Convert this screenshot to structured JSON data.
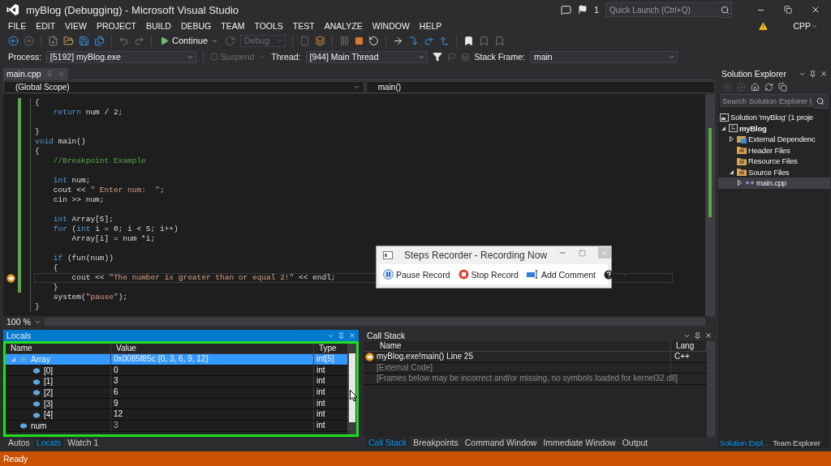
{
  "title_bar": {
    "title": "myBlog (Debugging) - Microsoft Visual Studio",
    "notification_count": "1",
    "quick_launch": {
      "placeholder": "Quick Launch (Ctrl+Q)"
    }
  },
  "menu": [
    "FILE",
    "EDIT",
    "VIEW",
    "PROJECT",
    "BUILD",
    "DEBUG",
    "TEAM",
    "TOOLS",
    "TEST",
    "ANALYZE",
    "WINDOW",
    "HELP"
  ],
  "profile": "CPP",
  "toolbar": {
    "continue": "Continue",
    "configuration": {
      "value": "Debug",
      "disabled": true
    }
  },
  "debug_location": {
    "process_label": "Process:",
    "process": "[5192] myBlog.exe",
    "suspend": {
      "label": "Suspend",
      "disabled": true
    },
    "thread_label": "Thread:",
    "thread": "[944] Main Thread",
    "stack_frame_label": "Stack Frame:",
    "stack_frame": "main"
  },
  "editor": {
    "tabs": [
      {
        "label": "main.cpp",
        "selected": true
      }
    ],
    "scope": "(Global Scope)",
    "member": "main()",
    "zoom": "100 %",
    "lines": [
      {
        "changed": true,
        "current": false,
        "tokens": [
          {
            "text": "{",
            "kind": "plain"
          }
        ]
      },
      {
        "changed": true,
        "current": false,
        "tokens": [
          {
            "text": "    return",
            "kind": "keyword"
          },
          {
            "text": " num / 2;",
            "kind": "plain"
          }
        ]
      },
      {
        "changed": true,
        "current": false
      },
      {
        "changed": true,
        "current": false,
        "tokens": [
          {
            "text": "}",
            "kind": "plain"
          }
        ]
      },
      {
        "changed": true,
        "current": false,
        "tokens": [
          {
            "text": "void",
            "kind": "keyword"
          },
          {
            "text": " main()",
            "kind": "plain"
          }
        ]
      },
      {
        "changed": true,
        "current": false,
        "tokens": [
          {
            "text": "{",
            "kind": "plain"
          }
        ]
      },
      {
        "changed": true,
        "current": false,
        "tokens": [
          {
            "text": "    //Breakpoint Example",
            "kind": "comment"
          }
        ]
      },
      {
        "changed": true,
        "current": false
      },
      {
        "changed": true,
        "current": false,
        "tokens": [
          {
            "text": "    int",
            "kind": "keyword"
          },
          {
            "text": " num;",
            "kind": "plain"
          }
        ]
      },
      {
        "changed": true,
        "current": false,
        "tokens": [
          {
            "text": "    cout << ",
            "kind": "plain"
          },
          {
            "text": "\" Enter num:  \"",
            "kind": "string"
          },
          {
            "text": ";",
            "kind": "plain"
          }
        ]
      },
      {
        "changed": true,
        "current": false,
        "tokens": [
          {
            "text": "    cin >> num;",
            "kind": "plain"
          }
        ]
      },
      {
        "changed": true,
        "current": false
      },
      {
        "changed": true,
        "current": false,
        "tokens": [
          {
            "text": "    int",
            "kind": "keyword"
          },
          {
            "text": " Array[5];",
            "kind": "plain"
          }
        ]
      },
      {
        "changed": true,
        "current": false,
        "tokens": [
          {
            "text": "    for",
            "kind": "keyword"
          },
          {
            "text": " (",
            "kind": "plain"
          },
          {
            "text": "int",
            "kind": "keyword"
          },
          {
            "text": " i = 0; i < 5; i++)",
            "kind": "plain"
          }
        ]
      },
      {
        "changed": true,
        "current": false,
        "tokens": [
          {
            "text": "        Array[i] = num *i;",
            "kind": "plain"
          }
        ]
      },
      {
        "changed": true,
        "current": false
      },
      {
        "changed": true,
        "current": false,
        "tokens": [
          {
            "text": "    if",
            "kind": "keyword"
          },
          {
            "text": " (fun(num))",
            "kind": "plain"
          }
        ]
      },
      {
        "changed": true,
        "current": false,
        "tokens": [
          {
            "text": "    {",
            "kind": "plain"
          }
        ]
      },
      {
        "changed": true,
        "current": true,
        "tokens": [
          {
            "text": "        cout << ",
            "kind": "plain"
          },
          {
            "text": "\"The number is greater than or equal 2!\"",
            "kind": "string"
          },
          {
            "text": " << endl;",
            "kind": "plain"
          }
        ]
      },
      {
        "changed": true,
        "current": false,
        "tokens": [
          {
            "text": "    }",
            "kind": "plain"
          }
        ]
      },
      {
        "changed": false,
        "current": false,
        "tokens": [
          {
            "text": "    system(",
            "kind": "plain"
          },
          {
            "text": "\"pause\"",
            "kind": "string"
          },
          {
            "text": ");",
            "kind": "plain"
          }
        ]
      },
      {
        "changed": false,
        "current": false,
        "tokens": [
          {
            "text": "}",
            "kind": "plain"
          }
        ]
      }
    ]
  },
  "locals": {
    "title": "Locals",
    "active": true,
    "columns": [
      "Name",
      "Value",
      "Type"
    ],
    "rows": [
      {
        "name": "Array",
        "value": "0x0085f85c {0, 3, 6, 9, 12}",
        "type": "int[5]",
        "selected": true,
        "expanded": true,
        "children": [
          {
            "name": "[0]",
            "value": "0",
            "type": "int",
            "selected": false
          },
          {
            "name": "[1]",
            "value": "3",
            "type": "int",
            "selected": false
          },
          {
            "name": "[2]",
            "value": "6",
            "type": "int",
            "selected": false
          },
          {
            "name": "[3]",
            "value": "9",
            "type": "int",
            "selected": false
          },
          {
            "name": "[4]",
            "value": "12",
            "type": "int",
            "selected": false
          }
        ]
      },
      {
        "name": "num",
        "value": "3",
        "type": "int",
        "selected": false
      }
    ],
    "tabs": [
      {
        "label": "Autos",
        "selected": false
      },
      {
        "label": "Locals",
        "selected": true
      },
      {
        "label": "Watch 1",
        "selected": false
      }
    ]
  },
  "call_stack": {
    "title": "Call Stack",
    "active": false,
    "columns": [
      "Name",
      "Lang"
    ],
    "rows": [
      {
        "name": "myBlog.exe!main() Line 25",
        "language": "C++",
        "current": true,
        "external": false
      },
      {
        "name": "[External Code]",
        "current": false,
        "external": true
      },
      {
        "name": "[Frames below may be incorrect and/or missing, no symbols loaded for kernel32.dll]",
        "current": false,
        "external": true
      }
    ],
    "tabs": [
      {
        "label": "Call Stack",
        "selected": true
      },
      {
        "label": "Breakpoints",
        "selected": false
      },
      {
        "label": "Command Window",
        "selected": false
      },
      {
        "label": "Immediate Window",
        "selected": false
      },
      {
        "label": "Output",
        "selected": false
      }
    ]
  },
  "solution_explorer": {
    "title": "Solution Explorer",
    "active": false,
    "search": {
      "placeholder": "Search Solution Explorer ("
    },
    "tree": [
      {
        "label": "Solution 'myBlog' (1 proje",
        "kind": "solution",
        "selected": false,
        "children": [
          {
            "label": "myBlog",
            "kind": "project",
            "expanded": true,
            "selected": false,
            "children": [
              {
                "label": "External Dependenc",
                "kind": "references",
                "expanded": false,
                "selected": false
              },
              {
                "label": "Header Files",
                "kind": "filter",
                "selected": false
              },
              {
                "label": "Resource Files",
                "kind": "filter",
                "selected": false
              },
              {
                "label": "Source Files",
                "kind": "filter",
                "expanded": true,
                "selected": false,
                "children": [
                  {
                    "label": "main.cpp",
                    "kind": "file",
                    "expanded": false,
                    "selected": true
                  }
                ]
              }
            ]
          }
        ]
      }
    ],
    "tabs": [
      {
        "label": "Solution Expl...",
        "selected": true
      },
      {
        "label": "Team Explorer",
        "selected": false
      }
    ]
  },
  "status_bar": {
    "text": "Ready"
  },
  "steps_recorder": {
    "title": "Steps Recorder - Recording Now",
    "buttons": [
      {
        "label": "Pause Record",
        "kind": "pause"
      },
      {
        "label": "Stop Record",
        "kind": "stop"
      },
      {
        "label": "Add Comment",
        "kind": "comment"
      }
    ]
  }
}
